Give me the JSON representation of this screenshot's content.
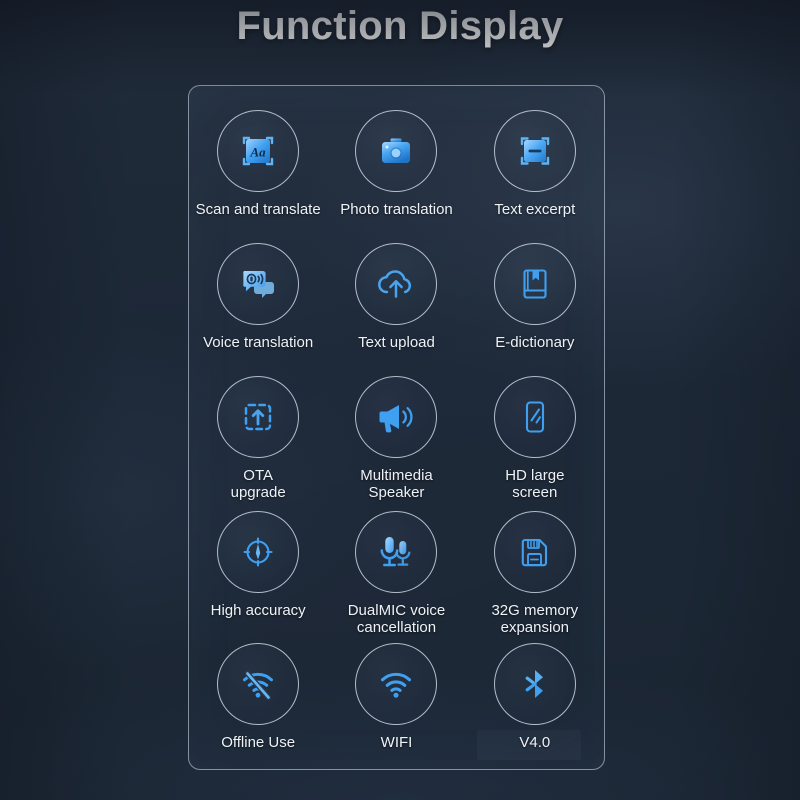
{
  "page": {
    "title": "Function Display",
    "background_color": "#1d2837",
    "panel_border_color": "#c4d0de",
    "icon_accent_color": "#3f9ff0",
    "icon_accent_light": "#8ecbff",
    "label_color": "#eef2f7"
  },
  "panel": {
    "rows": [
      {
        "cells": [
          {
            "label": "Scan and translate",
            "icon": "scan-translate-icon"
          },
          {
            "label": "Photo translation",
            "icon": "camera-icon"
          },
          {
            "label": "Text excerpt",
            "icon": "text-excerpt-icon"
          }
        ]
      },
      {
        "cells": [
          {
            "label": "Voice translation",
            "icon": "voice-translation-icon"
          },
          {
            "label": "Text upload",
            "icon": "cloud-upload-icon"
          },
          {
            "label": "E-dictionary",
            "icon": "book-bookmark-icon"
          }
        ]
      },
      {
        "cells": [
          {
            "label": "OTA\nupgrade",
            "icon": "ota-upgrade-icon"
          },
          {
            "label": "Multimedia\nSpeaker",
            "icon": "megaphone-icon"
          },
          {
            "label": "HD large\nscreen",
            "icon": "phone-screen-icon"
          }
        ]
      },
      {
        "cells": [
          {
            "label": "High accuracy",
            "icon": "crosshair-icon"
          },
          {
            "label": "DualMIC voice\ncancellation",
            "icon": "dual-microphone-icon"
          },
          {
            "label": "32G memory\nexpansion",
            "icon": "memory-card-icon"
          }
        ]
      },
      {
        "cells": [
          {
            "label": "Offline Use",
            "icon": "wifi-off-icon"
          },
          {
            "label": "WIFI",
            "icon": "wifi-icon"
          },
          {
            "label": "V4.0",
            "icon": "bluetooth-icon"
          }
        ]
      }
    ]
  }
}
